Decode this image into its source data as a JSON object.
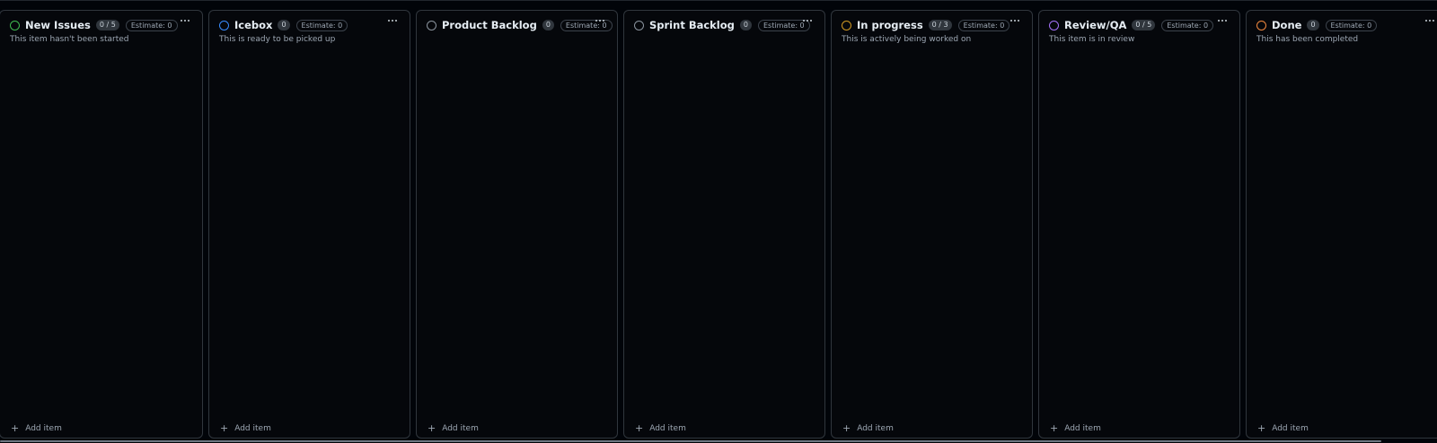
{
  "columns": [
    {
      "key": "new-issues",
      "title": "New Issues",
      "count": "0 / 5",
      "estimate": "Estimate: 0",
      "description": "This item hasn't been started",
      "color": "#3fb950",
      "add_label": "Add item"
    },
    {
      "key": "icebox",
      "title": "Icebox",
      "count": "0",
      "estimate": "Estimate: 0",
      "description": "This is ready to be picked up",
      "color": "#388bfd",
      "add_label": "Add item"
    },
    {
      "key": "product-backlog",
      "title": "Product Backlog",
      "count": "0",
      "estimate": "Estimate: 0",
      "description": "",
      "color": "#8b949e",
      "add_label": "Add item"
    },
    {
      "key": "sprint-backlog",
      "title": "Sprint Backlog",
      "count": "0",
      "estimate": "Estimate: 0",
      "description": "",
      "color": "#8b949e",
      "add_label": "Add item"
    },
    {
      "key": "in-progress",
      "title": "In progress",
      "count": "0 / 3",
      "estimate": "Estimate: 0",
      "description": "This is actively being worked on",
      "color": "#d29922",
      "add_label": "Add item"
    },
    {
      "key": "review-qa",
      "title": "Review/QA",
      "count": "0 / 5",
      "estimate": "Estimate: 0",
      "description": "This item is in review",
      "color": "#a371f7",
      "add_label": "Add item"
    },
    {
      "key": "done",
      "title": "Done",
      "count": "0",
      "estimate": "Estimate: 0",
      "description": "This has been completed",
      "color": "#f0883e",
      "add_label": "Add item"
    }
  ]
}
